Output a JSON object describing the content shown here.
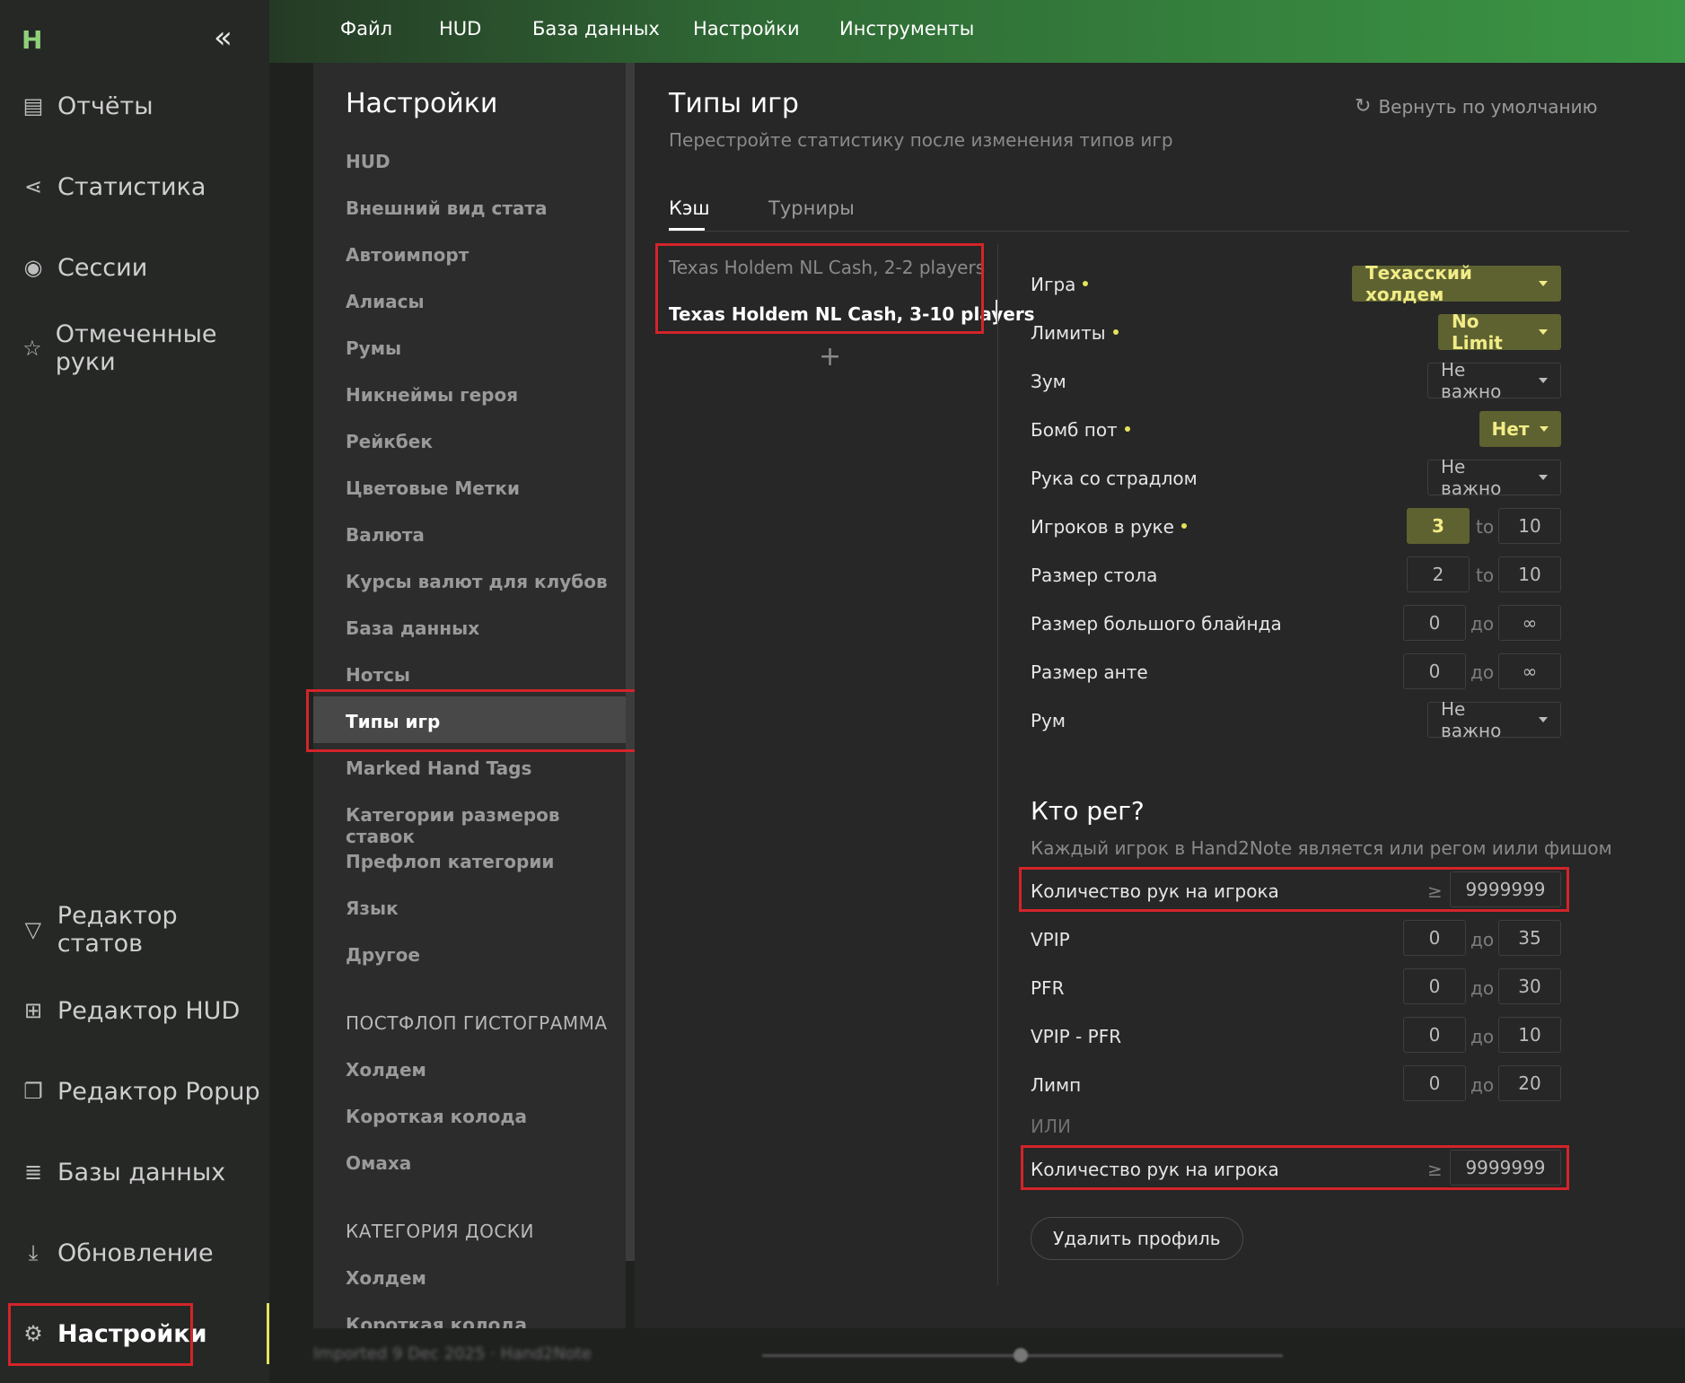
{
  "sidebar": {
    "items": [
      {
        "label": "Отчёты",
        "icon": "report-icon"
      },
      {
        "label": "Статистика",
        "icon": "share-icon"
      },
      {
        "label": "Сессии",
        "icon": "broadcast-icon"
      },
      {
        "label": "Отмеченные руки",
        "icon": "star-list-icon"
      },
      {
        "label": "Редактор статов",
        "icon": "filter-icon"
      },
      {
        "label": "Редактор HUD",
        "icon": "layout-icon"
      },
      {
        "label": "Редактор Popup",
        "icon": "windows-icon"
      },
      {
        "label": "Базы данных",
        "icon": "database-icon"
      },
      {
        "label": "Обновление",
        "icon": "download-icon"
      },
      {
        "label": "Настройки",
        "icon": "gear-icon"
      }
    ]
  },
  "menu": [
    "Файл",
    "HUD",
    "База данных",
    "Настройки",
    "Инструменты"
  ],
  "settings_nav": {
    "title": "Настройки",
    "items": [
      "HUD",
      "Внешний вид стата",
      "Автоимпорт",
      "Алиасы",
      "Румы",
      "Никнеймы героя",
      "Рейкбек",
      "Цветовые Метки",
      "Валюта",
      "Курсы валют для клубов",
      "База данных",
      "Нотсы",
      "Типы игр",
      "Marked Hand Tags",
      "Категории размеров ставок",
      "Префлоп категории",
      "Язык",
      "Другое"
    ],
    "section1": "ПОСТФЛОП ГИСТОГРАММА",
    "section1_items": [
      "Холдем",
      "Короткая колода",
      "Омаха"
    ],
    "section2": "КАТЕГОРИЯ ДОСКИ",
    "section2_items": [
      "Холдем",
      "Короткая колода"
    ]
  },
  "main": {
    "title": "Типы игр",
    "subtitle": "Перестройте статистику после изменения типов игр",
    "reset": "Вернуть по умолчанию",
    "tabs": [
      "Кэш",
      "Турниры"
    ],
    "profiles": [
      "Texas Holdem NL Cash, 2-2 players",
      "Texas Holdem NL Cash, 3-10 players"
    ],
    "plus": "+",
    "form": {
      "game_label": "Игра",
      "game_value": "Техасский холдем",
      "limits_label": "Лимиты",
      "limits_value": "No Limit",
      "zoom_label": "Зум",
      "zoom_value": "Не важно",
      "bomb_label": "Бомб пот",
      "bomb_value": "Нет",
      "straddle_label": "Рука со страдлом",
      "straddle_value": "Не важно",
      "players_label": "Игроков в руке",
      "players_from": "3",
      "players_to": "10",
      "table_label": "Размер стола",
      "table_from": "2",
      "table_to": "10",
      "bb_label": "Размер большого блайнда",
      "bb_from": "0",
      "bb_to": "∞",
      "ante_label": "Размер анте",
      "ante_from": "0",
      "ante_to": "∞",
      "room_label": "Рум",
      "room_value": "Не важно",
      "sep_to": "to",
      "sep_do": "до",
      "sep_ge": "≥"
    },
    "reg": {
      "title": "Кто рег?",
      "subtitle": "Каждый игрок в Hand2Note является или регом иили фишом",
      "hands_label": "Количество рук на игрока",
      "hands_value": "9999999",
      "vpip_label": "VPIP",
      "vpip_from": "0",
      "vpip_to": "35",
      "pfr_label": "PFR",
      "pfr_from": "0",
      "pfr_to": "30",
      "vpfr_label": "VPIP - PFR",
      "vpfr_from": "0",
      "vpfr_to": "10",
      "limp_label": "Лимп",
      "limp_from": "0",
      "limp_to": "20",
      "or": "ИЛИ",
      "hands2_label": "Количество рук на игрока",
      "hands2_value": "9999999"
    },
    "delete_button": "Удалить профиль"
  },
  "status": "Imported 9 Dec 2025 · Hand2Note",
  "colors": {
    "accent": "#3b9645",
    "highlight": "#5e6231",
    "highlight_text": "#f1ec86",
    "annotation": "#d3242a"
  }
}
